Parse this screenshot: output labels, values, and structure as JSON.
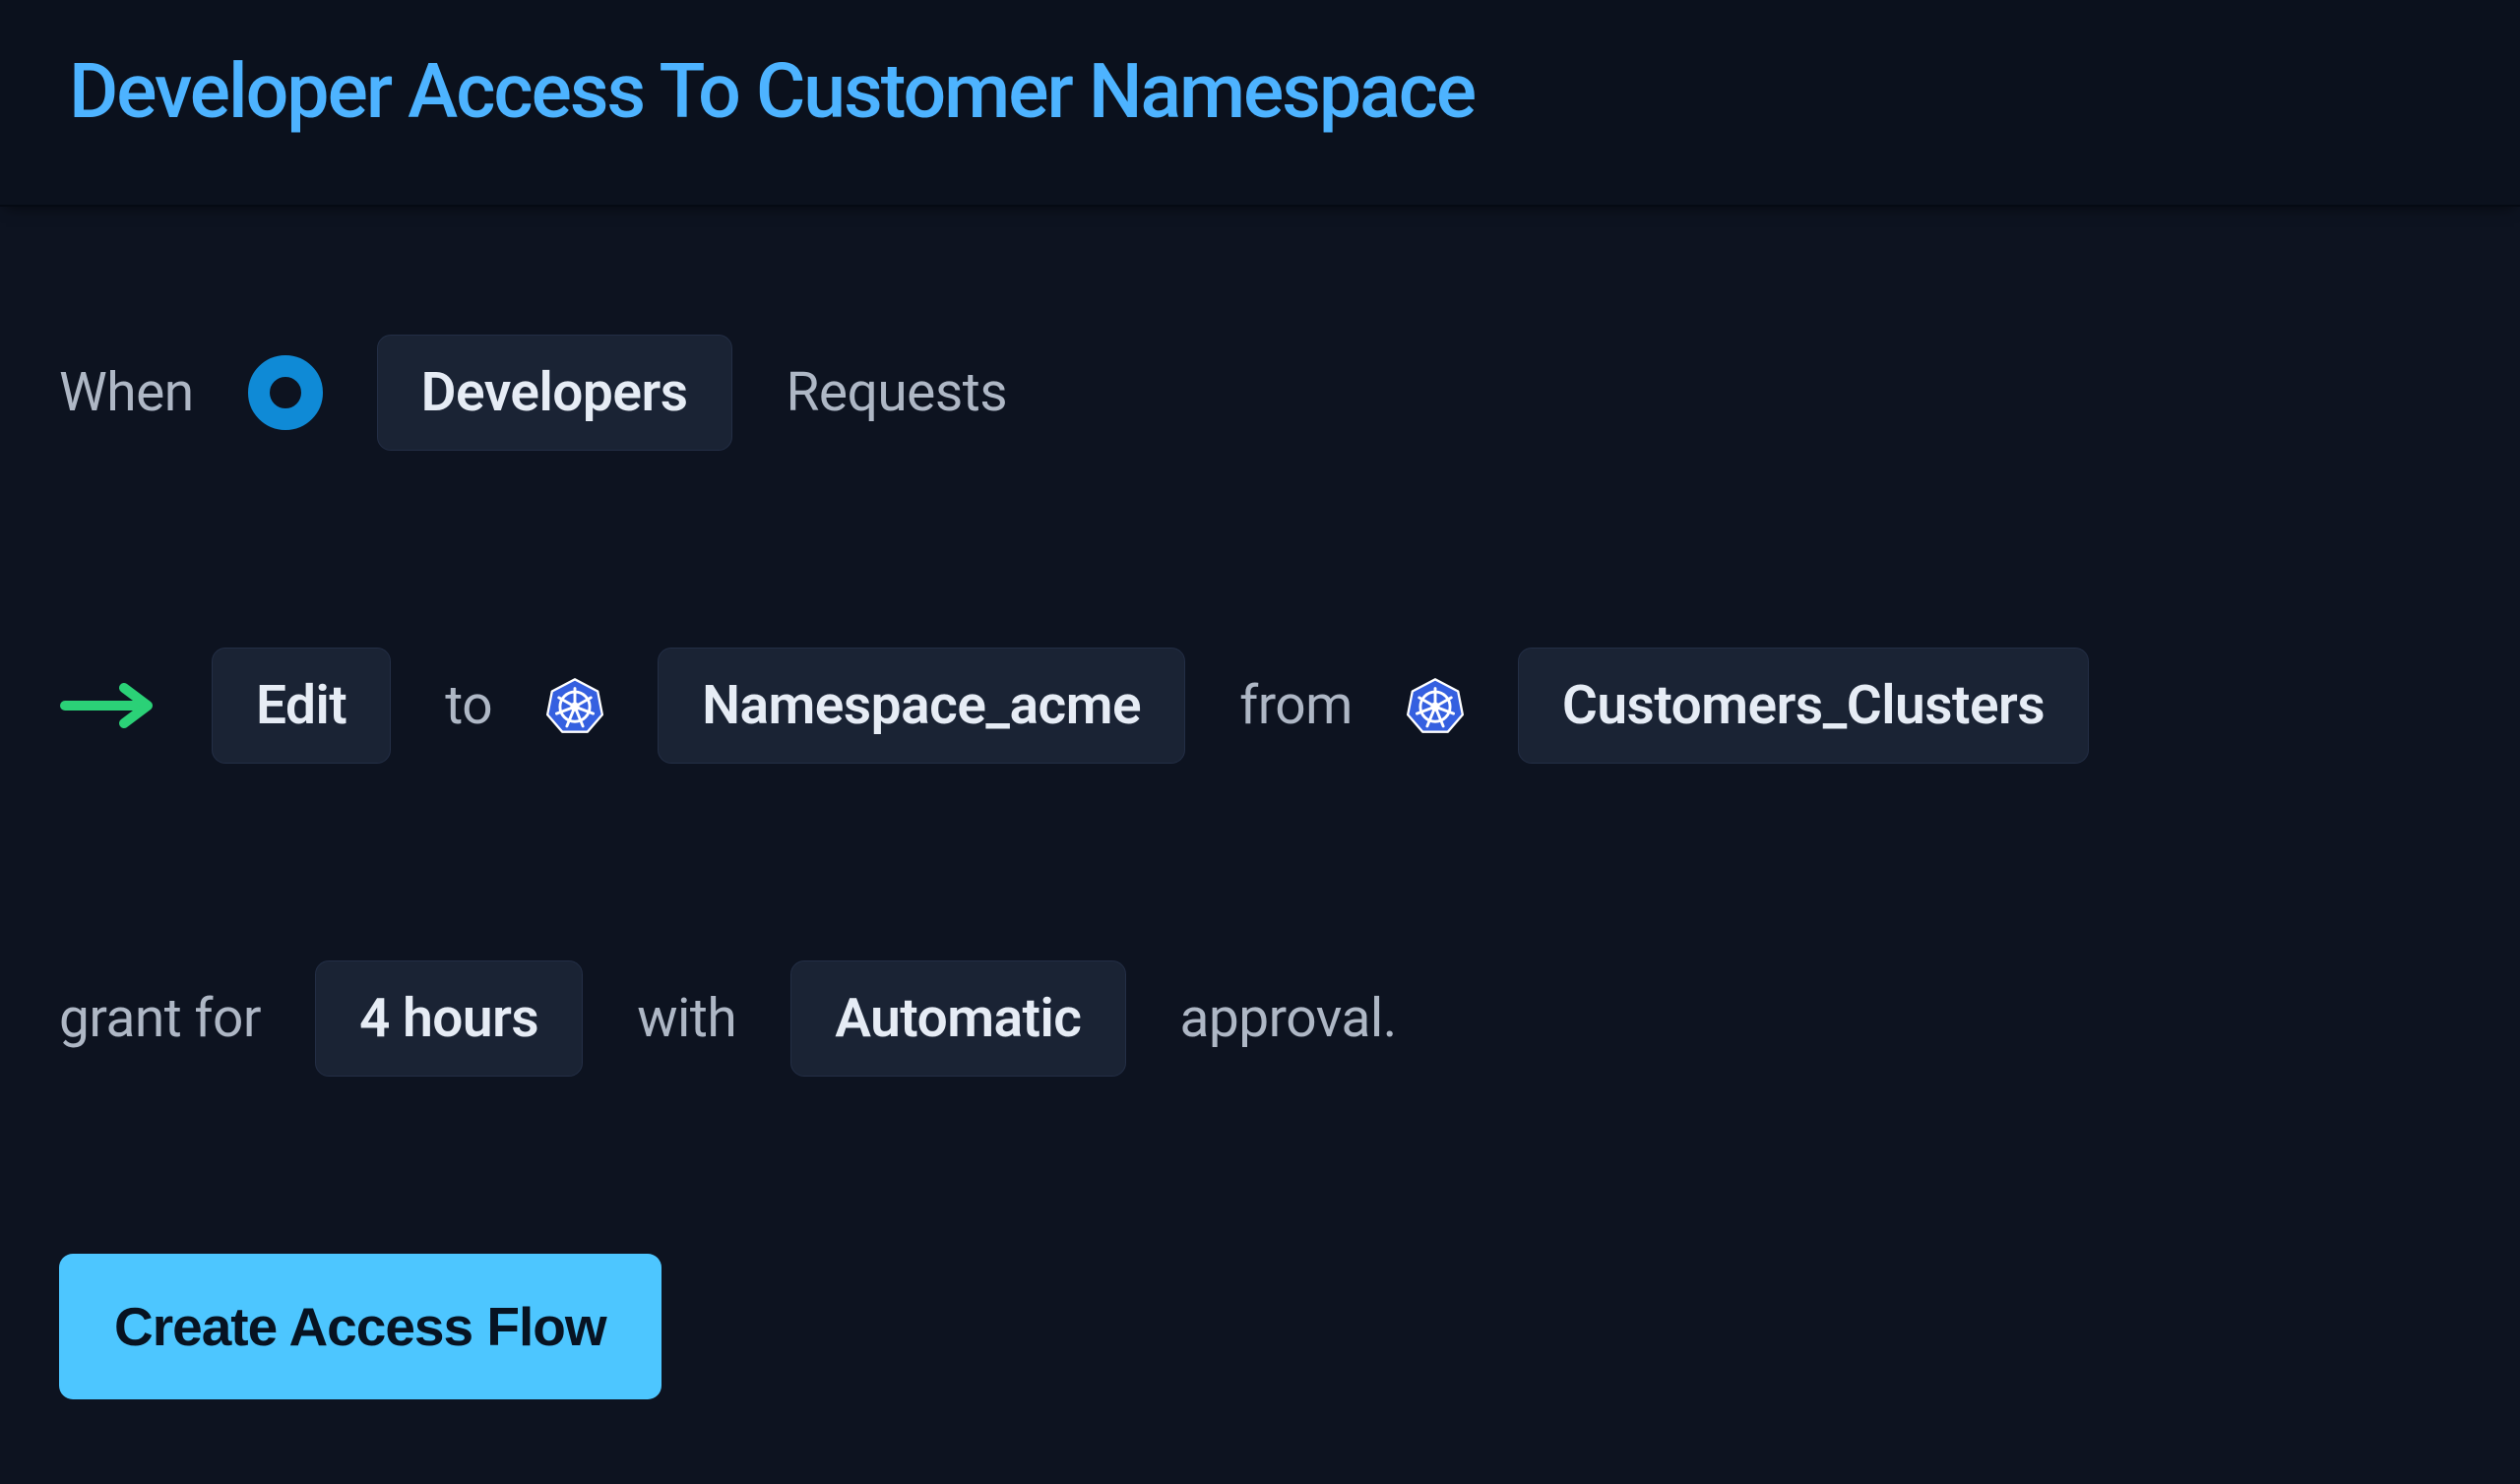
{
  "header": {
    "title": "Developer Access To Customer Namespace"
  },
  "flow": {
    "when_label": "When",
    "grantee_group": "Developers",
    "requests_label": "Requests",
    "permission": "Edit",
    "to_label": "to",
    "resource": "Namespace_acme",
    "from_label": "from",
    "cluster": "Customers_Clusters",
    "grant_for_label": "grant for",
    "duration": "4 hours",
    "with_label": "with",
    "approval_type": "Automatic",
    "approval_suffix": "approval."
  },
  "actions": {
    "create_label": "Create Access Flow"
  },
  "icons": {
    "grantee_marker": "circle-icon",
    "resource_kind": "kubernetes-icon",
    "cluster_kind": "kubernetes-icon",
    "arrow": "arrow-right-icon"
  }
}
